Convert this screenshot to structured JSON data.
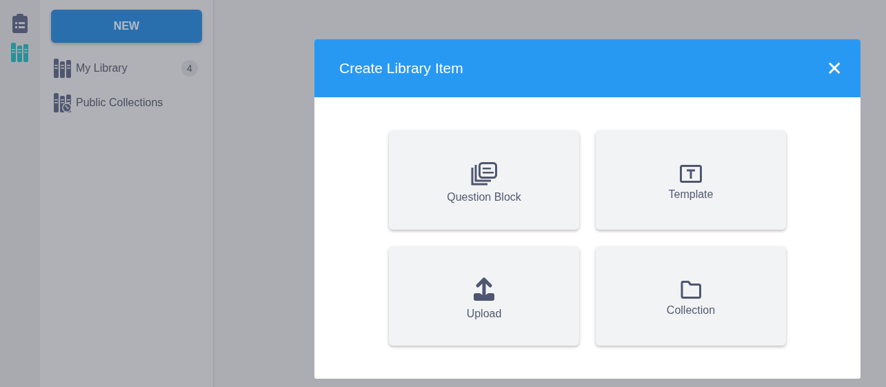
{
  "rail": [
    {
      "selected": false
    },
    {
      "selected": true
    }
  ],
  "sidebar": {
    "new_button": "NEW",
    "items": [
      {
        "label": "My Library",
        "badge": "4"
      },
      {
        "label": "Public Collections"
      }
    ]
  },
  "dialog": {
    "title": "Create Library Item",
    "close": "✕",
    "options": [
      {
        "label": "Question Block"
      },
      {
        "label": "Template"
      },
      {
        "label": "Upload"
      },
      {
        "label": "Collection"
      }
    ]
  }
}
